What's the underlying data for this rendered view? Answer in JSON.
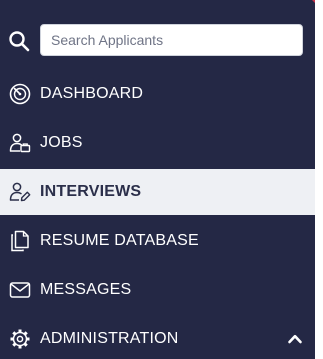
{
  "search": {
    "placeholder": "Search Applicants",
    "value": "",
    "icon": "search-icon"
  },
  "nav": {
    "items": [
      {
        "label": "DASHBOARD",
        "icon": "dashboard-icon",
        "active": false
      },
      {
        "label": "JOBS",
        "icon": "jobs-icon",
        "active": false
      },
      {
        "label": "INTERVIEWS",
        "icon": "interviews-icon",
        "active": true
      },
      {
        "label": "RESUME DATABASE",
        "icon": "documents-icon",
        "active": false
      },
      {
        "label": "MESSAGES",
        "icon": "envelope-icon",
        "active": false
      },
      {
        "label": "ADMINISTRATION",
        "icon": "gear-icon",
        "active": false,
        "expanded": true
      }
    ]
  },
  "colors": {
    "sidebar_bg": "#242845",
    "active_bg": "#eef0f4",
    "text": "#ffffff",
    "active_text": "#2b2f4a",
    "accent": "#c8334a"
  }
}
